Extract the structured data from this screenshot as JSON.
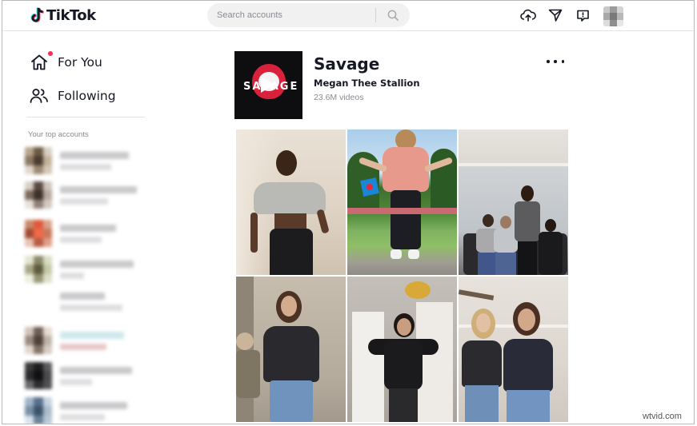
{
  "header": {
    "logo_text": "TikTok",
    "search_placeholder": "Search accounts",
    "icons": [
      "upload-icon",
      "send-icon",
      "inbox-icon"
    ]
  },
  "sidebar": {
    "nav": [
      {
        "label": "For You",
        "icon": "home-icon"
      },
      {
        "label": "Following",
        "icon": "users-icon"
      }
    ],
    "top_accounts_title": "Your top accounts"
  },
  "music": {
    "title": "Savage",
    "artist": "Megan Thee Stallion",
    "video_count": "23.6M videos",
    "cover_word": "SAVAGE"
  },
  "colors": {
    "accent": "#fe2c55",
    "text": "#161823",
    "muted": "#8a8b91"
  },
  "watermark": "wtvid.com"
}
